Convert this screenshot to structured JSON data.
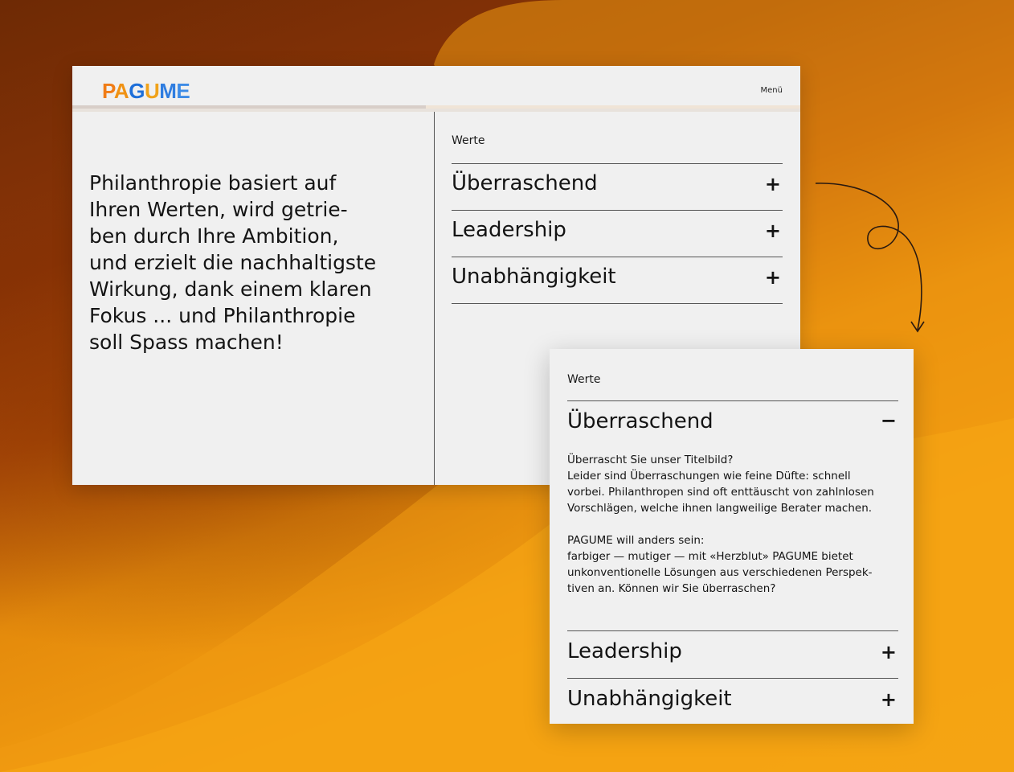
{
  "header": {
    "logo_letters": [
      "P",
      "A",
      "G",
      "U",
      "M",
      "E"
    ],
    "menu_label": "Menü"
  },
  "intro": {
    "text": "Philanthropie basiert auf\nIhren Werten, wird getrie-\nben durch Ihre Ambition,\nund erzielt die nachhaltigste\nWirkung, dank einem klaren\nFokus ... und Philanthropie\nsoll Spass machen!"
  },
  "values": {
    "label": "Werte",
    "items": [
      {
        "title": "Überraschend",
        "toggle": "+"
      },
      {
        "title": "Leadership",
        "toggle": "+"
      },
      {
        "title": "Unabhängigkeit",
        "toggle": "+"
      }
    ]
  },
  "card": {
    "label": "Werte",
    "expanded": {
      "title": "Überraschend",
      "toggle": "−",
      "body": "Überrascht Sie unser Titelbild?\nLeider sind Überraschungen wie feine Düfte: schnell\nvorbei. Philanthropen sind oft enttäuscht von zahlnlosen\nVorschlägen, welche ihnen langweilige Berater machen.\n\nPAGUME will anders sein:\nfarbiger — mutiger — mit «Herzblut» PAGUME bietet\nunkonventionelle Lösungen aus verschiedenen Perspek-\ntiven an. Können wir Sie überraschen?"
    },
    "items": [
      {
        "title": "Leadership",
        "toggle": "+"
      },
      {
        "title": "Unabhängigkeit",
        "toggle": "+"
      }
    ]
  },
  "colors": {
    "panel": "#f0f0f0",
    "text": "#141414",
    "logo_orange": "#f07c16",
    "logo_blue": "#1e6fd9"
  },
  "icons": {
    "arrow": "curly-arrow-icon"
  }
}
